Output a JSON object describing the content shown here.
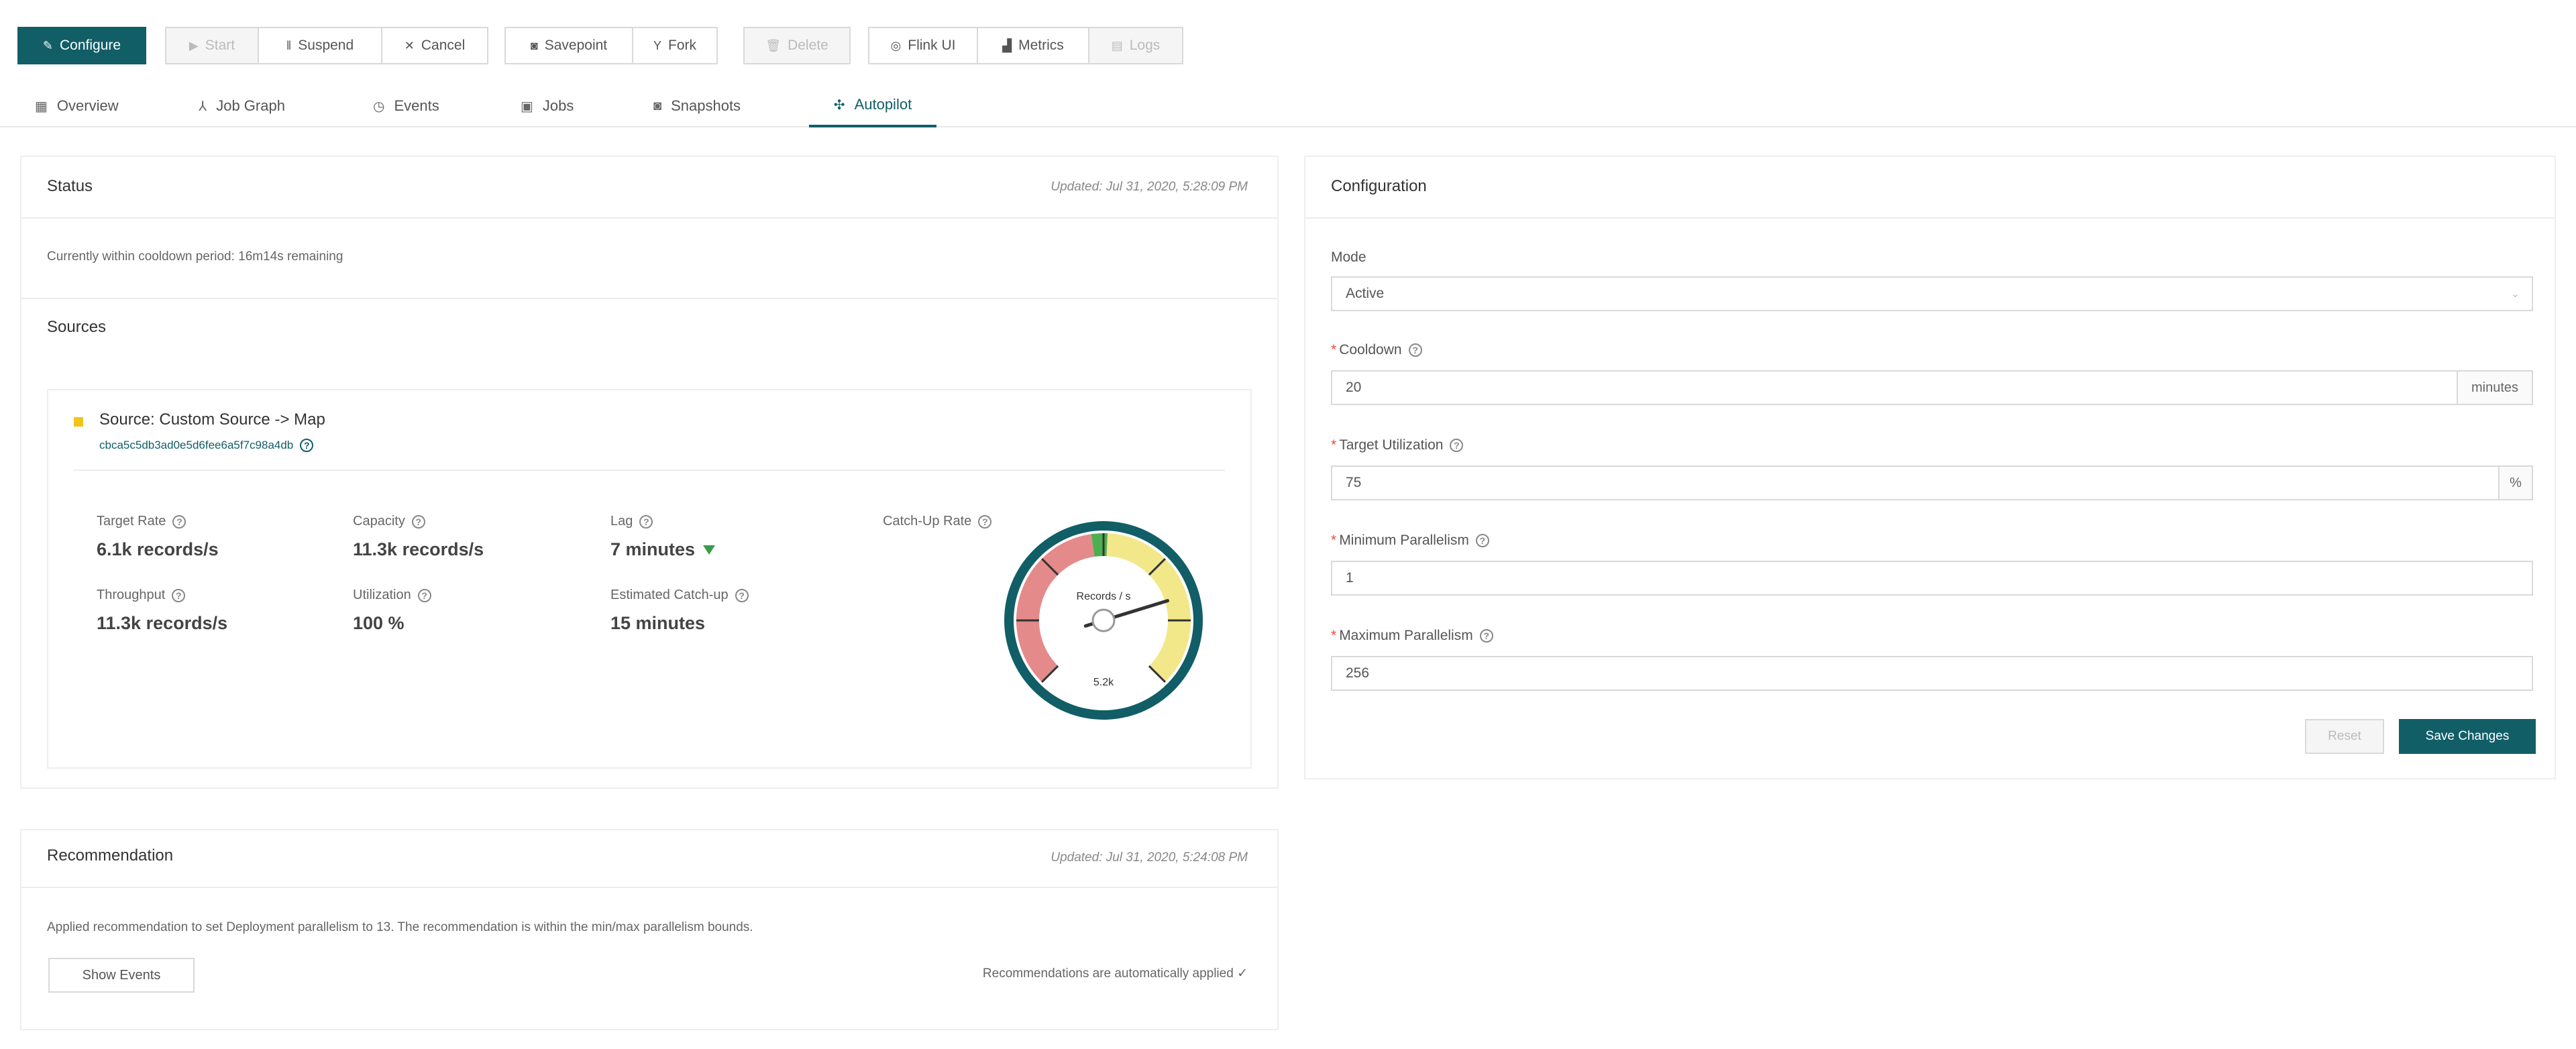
{
  "toolbar": {
    "configure": "Configure",
    "start": "Start",
    "suspend": "Suspend",
    "cancel": "Cancel",
    "savepoint": "Savepoint",
    "fork": "Fork",
    "delete": "Delete",
    "flink_ui": "Flink UI",
    "metrics": "Metrics",
    "logs": "Logs"
  },
  "tabs": [
    "Overview",
    "Job Graph",
    "Events",
    "Jobs",
    "Snapshots",
    "Autopilot"
  ],
  "status": {
    "title": "Status",
    "updated": "Updated: Jul 31, 2020, 5:28:09 PM",
    "cooldown_text": "Currently within cooldown period: 16m14s remaining",
    "sources_title": "Sources"
  },
  "source": {
    "name": "Source: Custom Source -> Map",
    "id": "cbca5c5db3ad0e5d6fee6a5f7c98a4db",
    "metrics": {
      "target_rate_label": "Target Rate",
      "target_rate_value": "6.1k records/s",
      "capacity_label": "Capacity",
      "capacity_value": "11.3k records/s",
      "lag_label": "Lag",
      "lag_value": "7 minutes",
      "catchup_rate_label": "Catch-Up Rate",
      "throughput_label": "Throughput",
      "throughput_value": "11.3k records/s",
      "utilization_label": "Utilization",
      "utilization_value": "100 %",
      "est_catchup_label": "Estimated Catch-up",
      "est_catchup_value": "15 minutes"
    },
    "gauge": {
      "label": "Records / s",
      "value_text": "5.2k",
      "needle_fraction": 0.77,
      "color_ring": "#115e67",
      "color_red": "#e58a8a",
      "color_yellow": "#f2e88a",
      "color_green": "#4caf50"
    }
  },
  "recommendation": {
    "title": "Recommendation",
    "updated": "Updated: Jul 31, 2020, 5:24:08 PM",
    "text": "Applied recommendation to set Deployment parallelism to 13. The recommendation is within the min/max parallelism bounds.",
    "show_events": "Show Events",
    "auto_note": "Recommendations are automatically applied ✓"
  },
  "configuration": {
    "title": "Configuration",
    "mode_label": "Mode",
    "mode_value": "Active",
    "cooldown_label": "Cooldown",
    "cooldown_value": "20",
    "cooldown_unit": "minutes",
    "target_util_label": "Target Utilization",
    "target_util_value": "75",
    "target_util_unit": "%",
    "min_par_label": "Minimum Parallelism",
    "min_par_value": "1",
    "max_par_label": "Maximum Parallelism",
    "max_par_value": "256",
    "reset": "Reset",
    "save": "Save Changes"
  },
  "colors": {
    "accent": "#115e67"
  }
}
